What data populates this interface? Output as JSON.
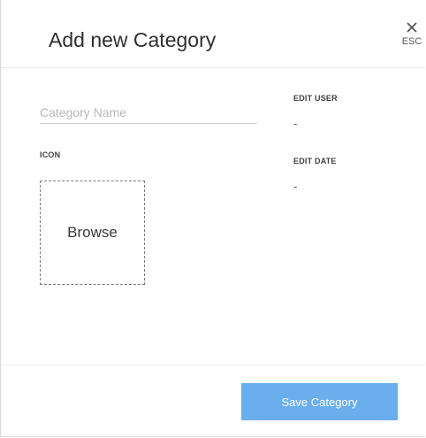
{
  "modal": {
    "title": "Add new Category"
  },
  "close": {
    "icon": "close-icon",
    "label": "ESC"
  },
  "form": {
    "category_name": {
      "placeholder": "Category Name",
      "value": ""
    },
    "icon_label": "ICON",
    "browse_label": "Browse"
  },
  "meta": {
    "edit_user_label": "EDIT USER",
    "edit_user_value": "-",
    "edit_date_label": "EDIT DATE",
    "edit_date_value": "-"
  },
  "footer": {
    "save_label": "Save Category"
  },
  "colors": {
    "primary_button": "#6aaeed",
    "title_text": "#2f2f2f",
    "dashed_border": "#7a7a7a"
  }
}
